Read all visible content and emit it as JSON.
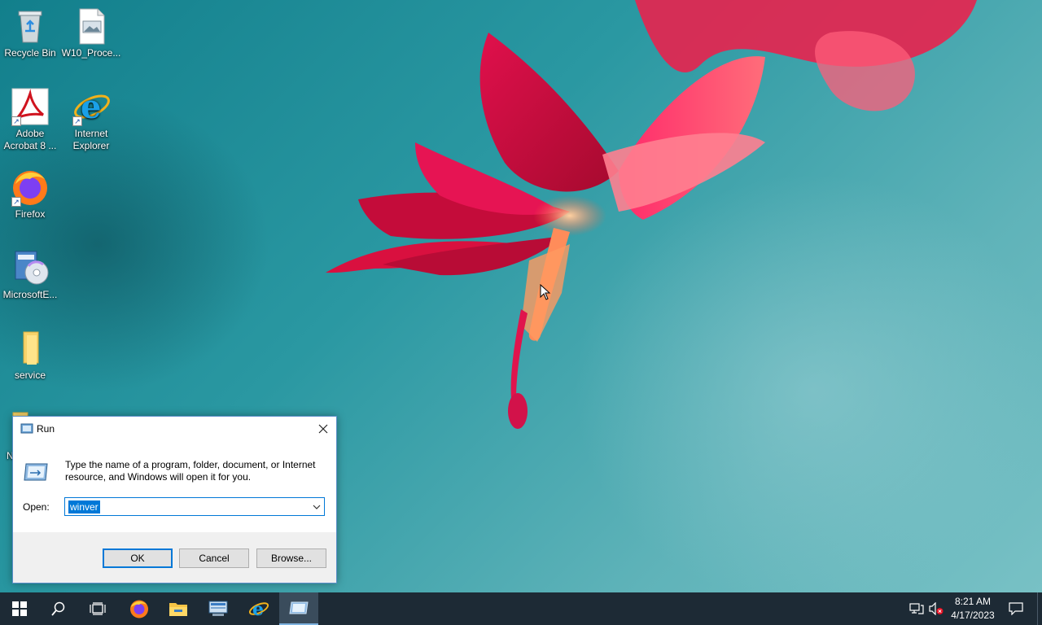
{
  "desktop": {
    "icons": [
      {
        "label": "Recycle Bin",
        "icon": "recycle-bin-icon"
      },
      {
        "label": "W10_Proce...",
        "icon": "image-file-icon"
      },
      {
        "label": "Adobe Acrobat 8 ...",
        "icon": "adobe-acrobat-icon"
      },
      {
        "label": "Internet Explorer",
        "icon": "internet-explorer-icon"
      },
      {
        "label": "Firefox",
        "icon": "firefox-icon"
      },
      {
        "label": "MicrosoftE...",
        "icon": "installer-cd-icon"
      },
      {
        "label": "service",
        "icon": "folder-icon"
      },
      {
        "label": "N",
        "icon": "folder-icon"
      }
    ]
  },
  "run_dialog": {
    "title": "Run",
    "description": "Type the name of a program, folder, document, or Internet resource, and Windows will open it for you.",
    "open_label": "Open:",
    "input_value": "winver",
    "ok_label": "OK",
    "cancel_label": "Cancel",
    "browse_label": "Browse..."
  },
  "taskbar": {
    "pinned": [
      "start-button",
      "search-icon",
      "task-view-icon",
      "firefox-icon",
      "file-explorer-icon",
      "server-manager-icon",
      "internet-explorer-icon",
      "run-icon"
    ],
    "clock": {
      "time": "8:21 AM",
      "date": "4/17/2023"
    }
  },
  "colors": {
    "accent": "#0078d7",
    "taskbar": "#1d2a35",
    "dialog_footer": "#f0f0f0"
  }
}
